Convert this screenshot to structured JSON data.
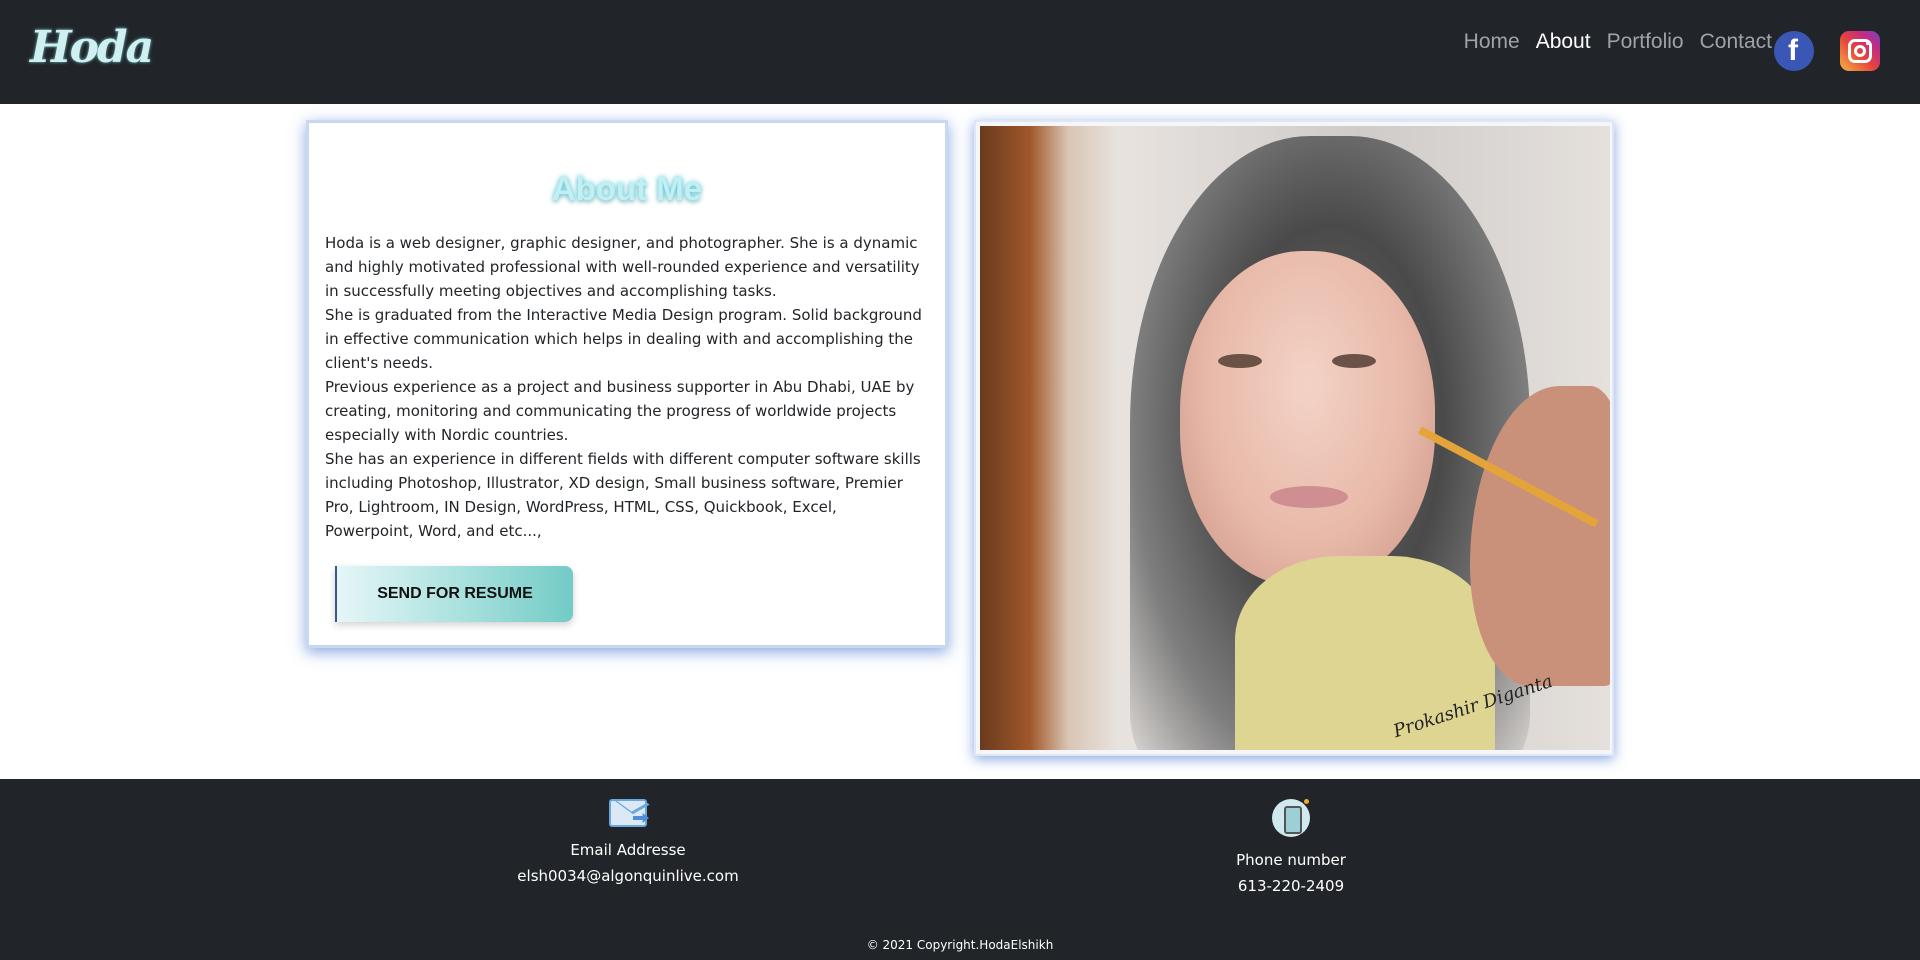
{
  "header": {
    "logo_text": "Hoda",
    "nav": [
      {
        "label": "Home",
        "active": false
      },
      {
        "label": "About",
        "active": true
      },
      {
        "label": "Portfolio",
        "active": false
      },
      {
        "label": "Contact",
        "active": false
      }
    ],
    "social": {
      "facebook_glyph": "f",
      "facebook_icon": "facebook-icon",
      "instagram_icon": "instagram-icon"
    }
  },
  "about": {
    "title": "About Me",
    "paragraphs": [
      "Hoda is a web designer, graphic designer, and photographer. She is a dynamic and highly motivated professional with well-rounded experience and versatility in successfully meeting objectives and accomplishing tasks.",
      "She is graduated from the Interactive Media Design program. Solid background in effective communication which helps in dealing with and accomplishing the client's needs.",
      "Previous experience as a project and business supporter in Abu Dhabi, UAE by creating, monitoring and communicating the progress of worldwide projects especially with Nordic countries.",
      "She has an experience in different fields with different computer software skills including Photoshop, Illustrator, XD design, Small business software, Premier Pro, Lightroom, IN Design, WordPress, HTML, CSS, Quickbook, Excel, Powerpoint, Word, and etc...,"
    ],
    "button_label": "SEND FOR RESUME"
  },
  "photo": {
    "signature": "Prokashir Diganta"
  },
  "footer": {
    "email_label": "Email Addresse",
    "email_value": "elsh0034@algonquinlive.com",
    "phone_label": "Phone number",
    "phone_value": "613-220-2409",
    "copyright": "© 2021 Copyright.HodaElshikh"
  },
  "colors": {
    "header_bg": "#212529",
    "footer_bg": "#212529",
    "accent": "#72cbc6",
    "card_shadow": "#4678d2"
  }
}
